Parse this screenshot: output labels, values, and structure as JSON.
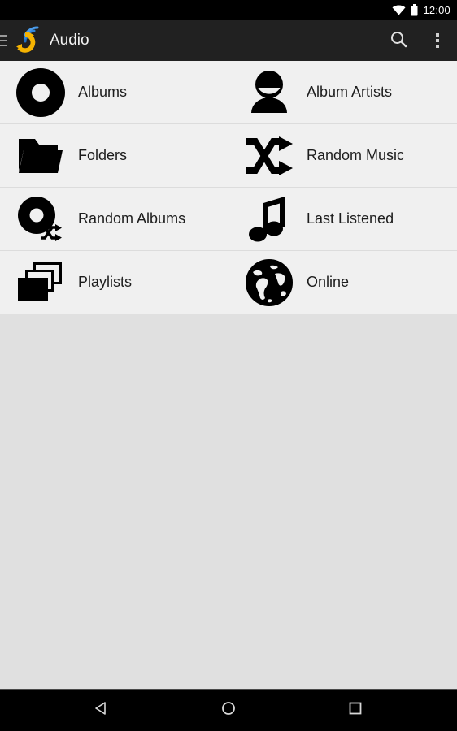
{
  "status_bar": {
    "time": "12:00",
    "icons": [
      "wifi-icon",
      "battery-icon"
    ]
  },
  "toolbar": {
    "drawer_icon": "hamburger-menu-icon",
    "app_logo": "audio-sync-logo-icon",
    "title": "Audio",
    "search_icon": "search-icon",
    "overflow_icon": "overflow-menu-icon",
    "background_color": "#212121",
    "title_color": "#f2f2f2"
  },
  "grid": {
    "tile_background": "#f0f0f0",
    "divider_color": "#dcdcdc",
    "icon_color": "#000000",
    "items": [
      {
        "label": "Albums",
        "icon": "disc-icon"
      },
      {
        "label": "Album Artists",
        "icon": "person-icon"
      },
      {
        "label": "Folders",
        "icon": "folder-icon"
      },
      {
        "label": "Random Music",
        "icon": "shuffle-icon"
      },
      {
        "label": "Random Albums",
        "icon": "disc-shuffle-icon"
      },
      {
        "label": "Last Listened",
        "icon": "music-note-icon"
      },
      {
        "label": "Playlists",
        "icon": "stacked-layers-icon"
      },
      {
        "label": "Online",
        "icon": "globe-icon"
      }
    ]
  },
  "page": {
    "background_color": "#e0e0e0"
  },
  "nav_bar": {
    "background_color": "#000000",
    "buttons": [
      {
        "name": "back-button",
        "icon": "triangle-left-icon"
      },
      {
        "name": "home-button",
        "icon": "circle-icon"
      },
      {
        "name": "recents-button",
        "icon": "square-icon"
      }
    ]
  }
}
